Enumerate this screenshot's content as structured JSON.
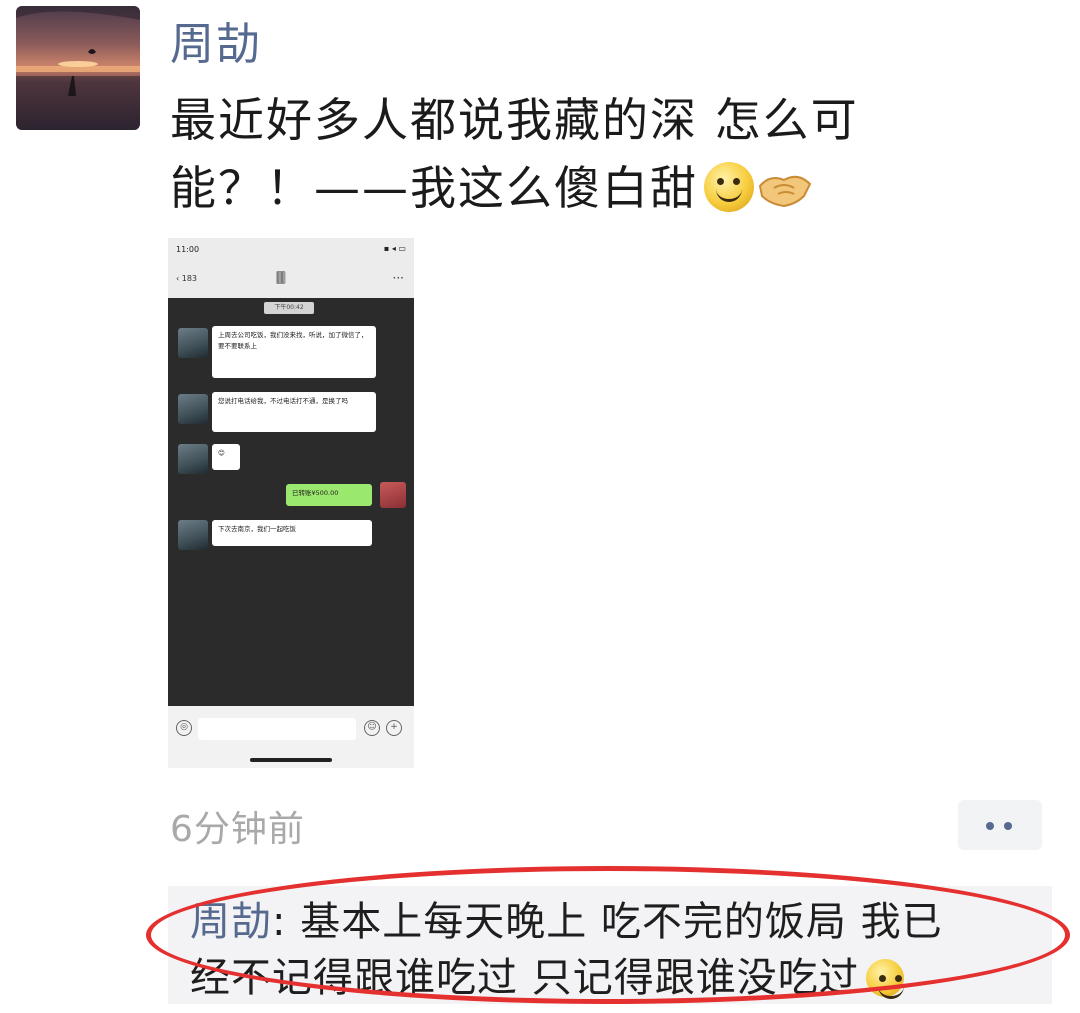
{
  "post": {
    "author": "周劼",
    "text_line1": "最近好多人都说我藏的深   怎么可",
    "text_line2": "能？！——我这么傻白甜",
    "emojis": [
      "smile-emoji",
      "handshake-emoji"
    ],
    "timestamp": "6分钟前"
  },
  "phone_screenshot": {
    "status_time": "11:00",
    "status_icons": "▪ ◂ ▭",
    "back_label": "‹ 183",
    "header_title": "🀫",
    "more_label": "···",
    "time_pill": "下午00:42",
    "messages": [
      {
        "from": "other",
        "text": "上周去公司吃饭，我们没来找，听说，加了微信了，要不要联系上"
      },
      {
        "from": "other",
        "text": "您说打电话给我，不过电话打不通，是换了吗"
      },
      {
        "from": "other",
        "text": "😊"
      },
      {
        "from": "me",
        "text": "已转账¥500.00"
      },
      {
        "from": "other",
        "text": "下次去南京，我们一起吃饭"
      }
    ]
  },
  "comment": {
    "author": "周劼",
    "separator": ": ",
    "text_line1": "基本上每天晚上 吃不完的饭局    我已",
    "text_line2": "经不记得跟谁吃过  只记得跟谁没吃过"
  },
  "colors": {
    "name_blue": "#56698f",
    "timestamp_gray": "#a9a9a9",
    "highlight_red": "#e53030"
  }
}
